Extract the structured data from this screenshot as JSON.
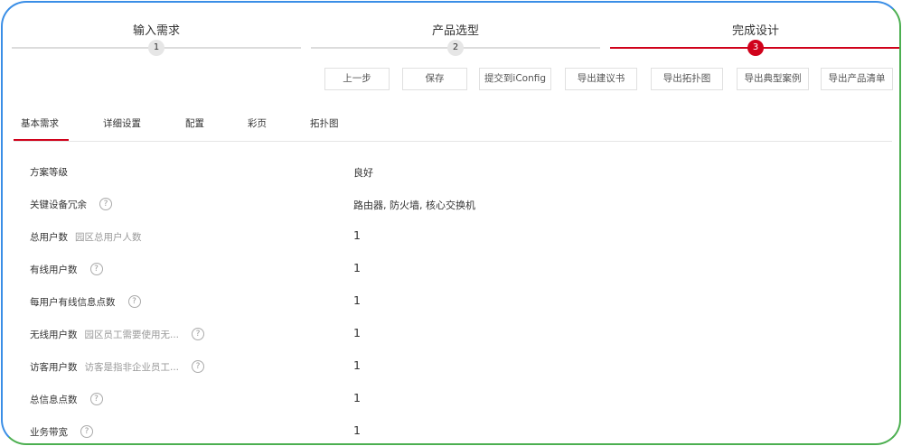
{
  "steps": [
    {
      "label": "输入需求",
      "number": "1",
      "active": false
    },
    {
      "label": "产品选型",
      "number": "2",
      "active": false
    },
    {
      "label": "完成设计",
      "number": "3",
      "active": true
    }
  ],
  "colors": {
    "accent": "#d0021b",
    "border_blue": "#3a8ee6",
    "border_green": "#4caf50"
  },
  "toolbar": {
    "prev": "上一步",
    "save": "保存",
    "submit": "提交到iConfig",
    "export_proposal": "导出建议书",
    "export_topology": "导出拓扑图",
    "export_case": "导出典型案例",
    "export_list": "导出产品清单"
  },
  "tabs": [
    {
      "label": "基本需求",
      "active": true
    },
    {
      "label": "详细设置",
      "active": false
    },
    {
      "label": "配置",
      "active": false
    },
    {
      "label": "彩页",
      "active": false
    },
    {
      "label": "拓扑图",
      "active": false
    }
  ],
  "rows": [
    {
      "label": "方案等级",
      "hint": "",
      "help": false,
      "value": "良好"
    },
    {
      "label": "关键设备冗余",
      "hint": "",
      "help": true,
      "value": "路由器, 防火墙, 核心交换机"
    },
    {
      "label": "总用户数",
      "hint": "园区总用户人数",
      "help": false,
      "value": "1"
    },
    {
      "label": "有线用户数",
      "hint": "",
      "help": true,
      "value": "1"
    },
    {
      "label": "每用户有线信息点数",
      "hint": "",
      "help": true,
      "value": "1"
    },
    {
      "label": "无线用户数",
      "hint": "园区员工需要使用无...",
      "help": true,
      "value": "1"
    },
    {
      "label": "访客用户数",
      "hint": "访客是指非企业员工...",
      "help": true,
      "value": "1"
    },
    {
      "label": "总信息点数",
      "hint": "",
      "help": true,
      "value": "1"
    },
    {
      "label": "业务带宽",
      "hint": "",
      "help": true,
      "value": "1"
    }
  ],
  "icons": {
    "help": "?"
  }
}
